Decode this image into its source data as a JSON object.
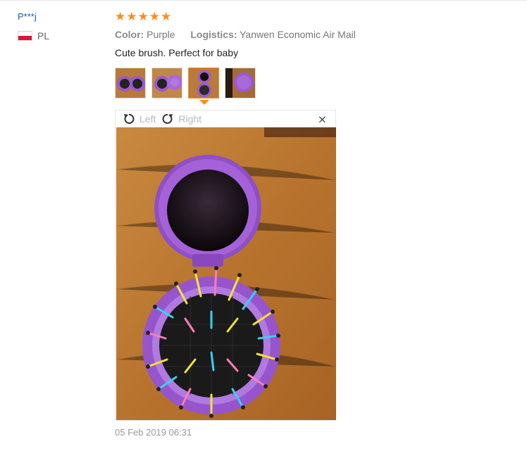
{
  "review": {
    "user": "P***j",
    "country_code": "PL",
    "rating": 5,
    "attributes": {
      "color_label": "Color:",
      "color_value": "Purple",
      "logistics_label": "Logistics:",
      "logistics_value": "Yanwen Economic Air Mail"
    },
    "text": "Cute brush. Perfect for baby",
    "date": "05 Feb 2019 06:31",
    "thumbnail_count": 4,
    "active_thumbnail": 3
  },
  "viewer": {
    "rotate_left_label": "Left",
    "rotate_right_label": "Right",
    "close_label": "×"
  },
  "icons": {
    "star": "star-icon",
    "rotate_left": "rotate-left-icon",
    "rotate_right": "rotate-right-icon",
    "close": "close-icon"
  },
  "colors": {
    "star": "#ff8c1a",
    "user_link": "#1e5aa8",
    "thumb_active_border": "#ff8c1a",
    "brush_purple": "#9b59d0"
  }
}
